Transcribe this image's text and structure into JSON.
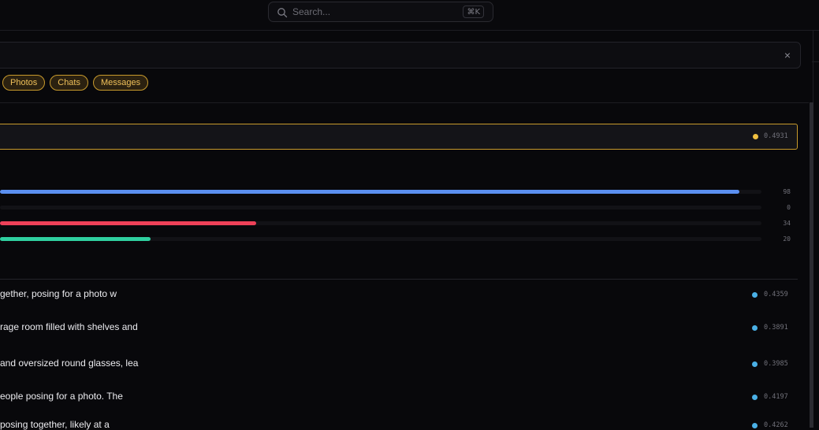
{
  "search": {
    "placeholder": "Search...",
    "shortcut": "⌘K",
    "icon": "search-icon"
  },
  "query_box": {
    "close_label": "×"
  },
  "filters": [
    "Photos",
    "Chats",
    "Messages"
  ],
  "top_result": {
    "score": "0.4931",
    "dot_color": "#f0c040"
  },
  "bars": [
    {
      "value": 98,
      "label": "98",
      "color": "#5b8ff0"
    },
    {
      "value": 0,
      "label": "0",
      "color": "#8a8a92"
    },
    {
      "value": 34,
      "label": "34",
      "color": "#ee4158"
    },
    {
      "value": 20,
      "label": "20",
      "color": "#2fd0a0"
    }
  ],
  "results": [
    {
      "text": "gether, posing for a photo w",
      "score": "0.4359"
    },
    {
      "text": "rage room filled with shelves and",
      "score": "0.3891"
    },
    {
      "text": " and oversized round glasses, lea",
      "score": "0.3985"
    },
    {
      "text": "eople posing for a photo. The",
      "score": "0.4197"
    },
    {
      "text": "posing together, likely at a",
      "score": "0.4262"
    }
  ],
  "colors": {
    "accent": "#c89a2c",
    "result_dot": "#4ab0e6"
  }
}
